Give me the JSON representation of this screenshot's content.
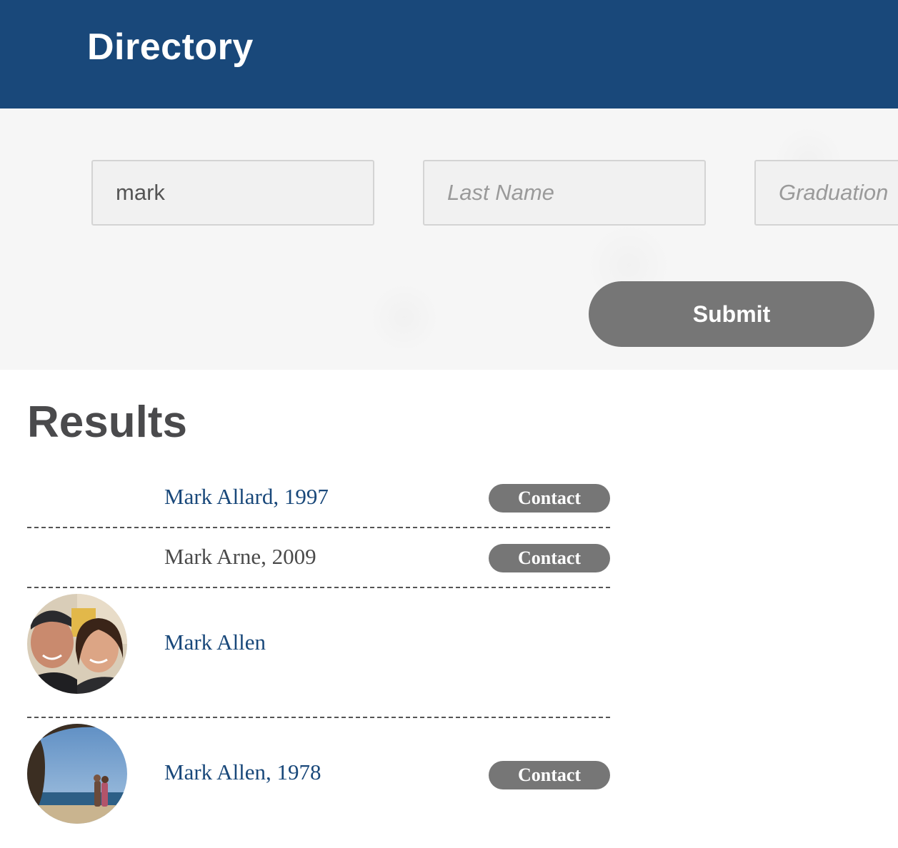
{
  "header": {
    "title": "Directory"
  },
  "search": {
    "first_name_value": "mark",
    "last_name_placeholder": "Last Name",
    "graduation_placeholder": "Graduation",
    "submit_label": "Submit"
  },
  "results": {
    "heading": "Results",
    "items": [
      {
        "name": "Mark Allard, 1997",
        "contact_label": "Contact",
        "has_avatar": false
      },
      {
        "name": "Mark Arne, 2009",
        "contact_label": "Contact",
        "has_avatar": false
      },
      {
        "name": "Mark Allen",
        "has_avatar": true,
        "avatar_icon": "couple-selfie-photo"
      },
      {
        "name": "Mark Allen, 1978",
        "contact_label": "Contact",
        "has_avatar": true,
        "avatar_icon": "beach-couple-photo"
      }
    ]
  },
  "colors": {
    "header_bg": "#19487a",
    "link": "#19487a",
    "button_bg": "#767676",
    "heading_text": "#4a4a4c"
  }
}
